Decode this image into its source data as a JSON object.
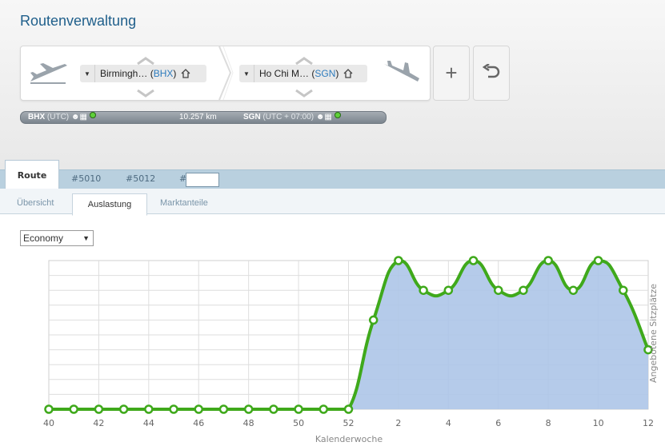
{
  "page": {
    "title": "Routenverwaltung"
  },
  "route": {
    "departure": {
      "name": "Birmingh…",
      "code": "BHX"
    },
    "arrival": {
      "name": "Ho Chi M…",
      "code": "SGN"
    },
    "add_label": "+",
    "info": {
      "dep_code": "BHX",
      "dep_tz": "(UTC)",
      "distance": "10.257 km",
      "arr_code": "SGN",
      "arr_tz": "(UTC + 07:00)"
    }
  },
  "tabs": {
    "route": "Route",
    "flights": [
      "#5010",
      "#5012"
    ],
    "new_prefix": "#"
  },
  "subtabs": {
    "overview": "Übersicht",
    "load": "Auslastung",
    "market": "Marktanteile"
  },
  "class_select": {
    "value": "Economy"
  },
  "colors": {
    "line": "#3fa91b",
    "fill": "#adc5e8",
    "accent": "#1f5f8b"
  },
  "chart_data": {
    "type": "area",
    "xlabel": "Kalenderwoche",
    "ylabel": "Angebotene Sitzplätze",
    "x": [
      "40",
      "41",
      "42",
      "43",
      "44",
      "45",
      "46",
      "47",
      "48",
      "49",
      "50",
      "51",
      "52",
      "1",
      "2",
      "3",
      "4",
      "5",
      "6",
      "7",
      "8",
      "9",
      "10",
      "11",
      "12"
    ],
    "tick_labels": [
      "40",
      "42",
      "44",
      "46",
      "48",
      "50",
      "52",
      "2",
      "4",
      "6",
      "8",
      "10",
      "12"
    ],
    "values": [
      0,
      0,
      0,
      0,
      0,
      0,
      0,
      0,
      0,
      0,
      0,
      0,
      0,
      6,
      10,
      8,
      8,
      10,
      8,
      8,
      10,
      8,
      10,
      8,
      4
    ],
    "ylim": [
      0,
      10
    ],
    "grid": true
  }
}
